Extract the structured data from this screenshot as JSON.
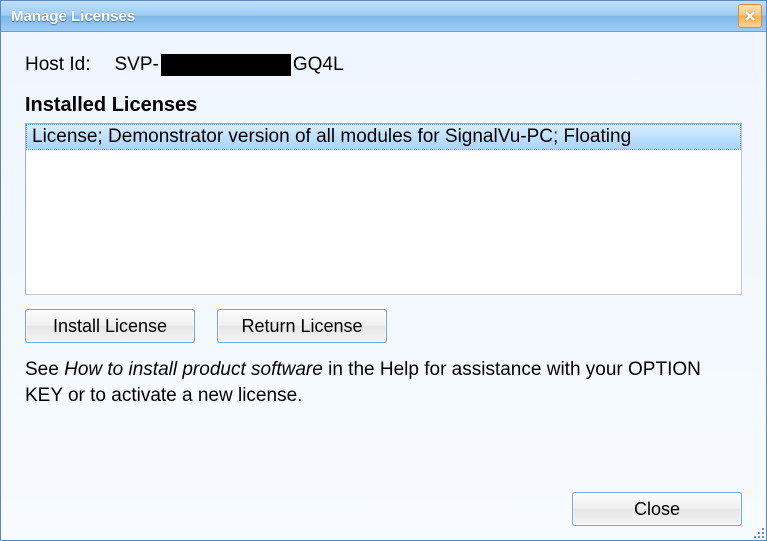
{
  "window": {
    "title": "Manage Licenses"
  },
  "host": {
    "label": "Host Id:",
    "value_prefix": "SVP-",
    "value_suffix": "GQ4L"
  },
  "licenses": {
    "section_title": "Installed Licenses",
    "items": [
      {
        "text": "License; Demonstrator version of all modules for SignalVu-PC; Floating",
        "selected": true
      }
    ]
  },
  "buttons": {
    "install": "Install License",
    "return": "Return License",
    "close": "Close"
  },
  "help": {
    "pre": "See ",
    "italic": "How to install product software",
    "post": " in the Help for assistance with your OPTION KEY or to activate a new license."
  }
}
